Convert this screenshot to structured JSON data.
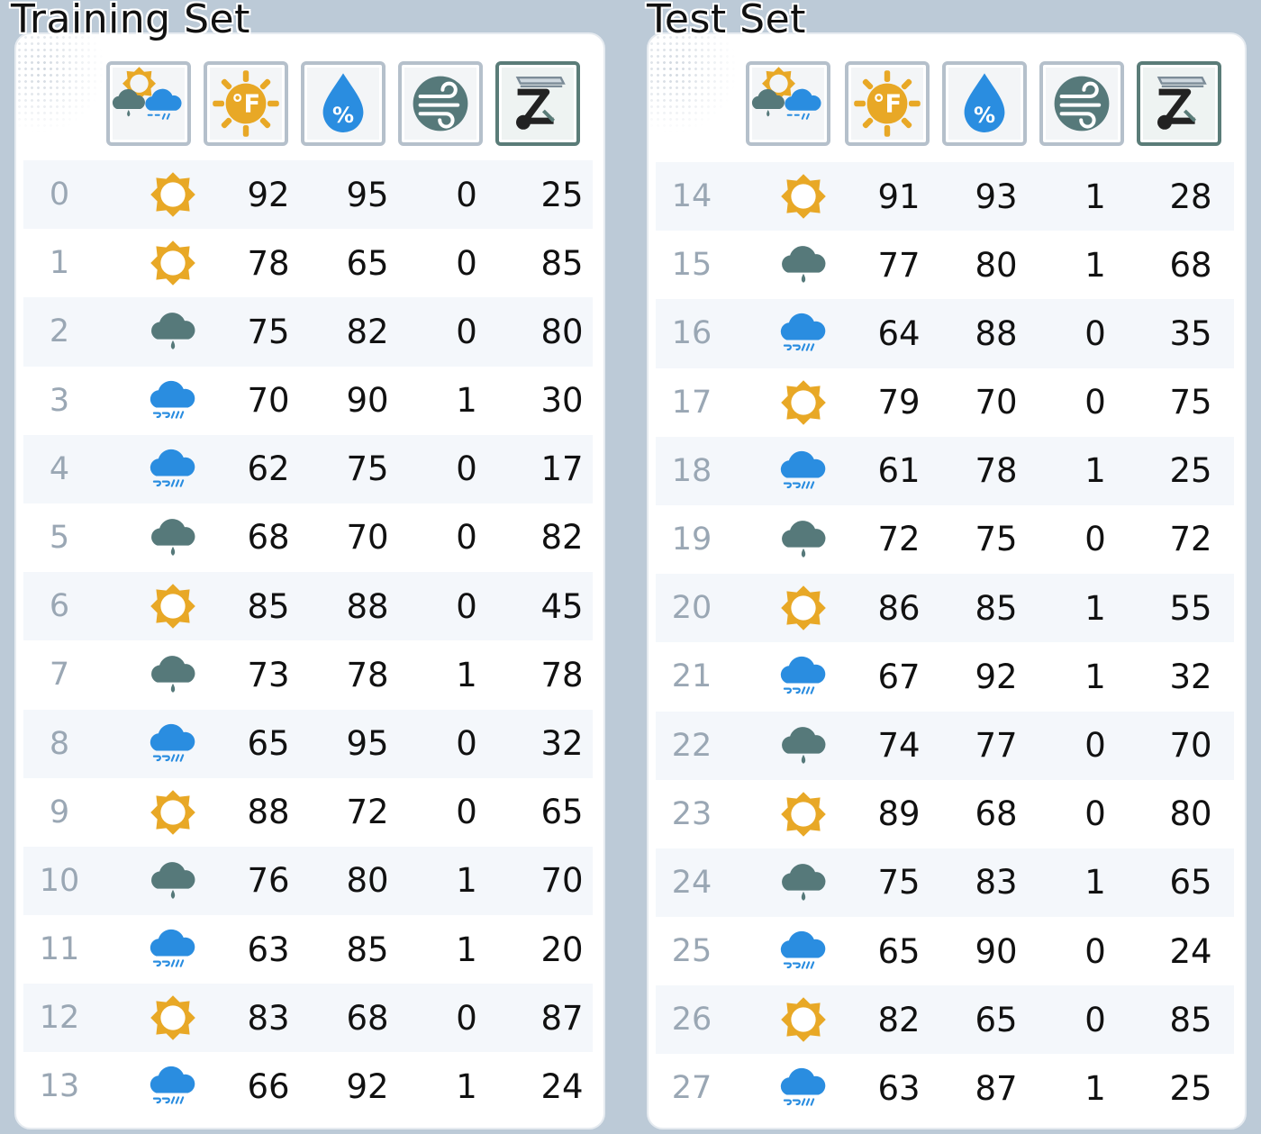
{
  "panels": [
    {
      "id": "train",
      "title": "Training Set",
      "rows": [
        {
          "idx": "0",
          "weather": "sunny",
          "temp": "92",
          "humidity": "95",
          "wind": "0",
          "target": "25"
        },
        {
          "idx": "1",
          "weather": "sunny",
          "temp": "78",
          "humidity": "65",
          "wind": "0",
          "target": "85"
        },
        {
          "idx": "2",
          "weather": "rainy-dark",
          "temp": "75",
          "humidity": "82",
          "wind": "0",
          "target": "80"
        },
        {
          "idx": "3",
          "weather": "rainy-blue",
          "temp": "70",
          "humidity": "90",
          "wind": "1",
          "target": "30"
        },
        {
          "idx": "4",
          "weather": "rainy-blue",
          "temp": "62",
          "humidity": "75",
          "wind": "0",
          "target": "17"
        },
        {
          "idx": "5",
          "weather": "rainy-dark",
          "temp": "68",
          "humidity": "70",
          "wind": "0",
          "target": "82"
        },
        {
          "idx": "6",
          "weather": "sunny",
          "temp": "85",
          "humidity": "88",
          "wind": "0",
          "target": "45"
        },
        {
          "idx": "7",
          "weather": "rainy-dark",
          "temp": "73",
          "humidity": "78",
          "wind": "1",
          "target": "78"
        },
        {
          "idx": "8",
          "weather": "rainy-blue",
          "temp": "65",
          "humidity": "95",
          "wind": "0",
          "target": "32"
        },
        {
          "idx": "9",
          "weather": "sunny",
          "temp": "88",
          "humidity": "72",
          "wind": "0",
          "target": "65"
        },
        {
          "idx": "10",
          "weather": "rainy-dark",
          "temp": "76",
          "humidity": "80",
          "wind": "1",
          "target": "70"
        },
        {
          "idx": "11",
          "weather": "rainy-blue",
          "temp": "63",
          "humidity": "85",
          "wind": "1",
          "target": "20"
        },
        {
          "idx": "12",
          "weather": "sunny",
          "temp": "83",
          "humidity": "68",
          "wind": "0",
          "target": "87"
        },
        {
          "idx": "13",
          "weather": "rainy-blue",
          "temp": "66",
          "humidity": "92",
          "wind": "1",
          "target": "24"
        }
      ]
    },
    {
      "id": "test",
      "title": "Test Set",
      "rows": [
        {
          "idx": "14",
          "weather": "sunny",
          "temp": "91",
          "humidity": "93",
          "wind": "1",
          "target": "28"
        },
        {
          "idx": "15",
          "weather": "rainy-dark",
          "temp": "77",
          "humidity": "80",
          "wind": "1",
          "target": "68"
        },
        {
          "idx": "16",
          "weather": "rainy-blue",
          "temp": "64",
          "humidity": "88",
          "wind": "0",
          "target": "35"
        },
        {
          "idx": "17",
          "weather": "sunny",
          "temp": "79",
          "humidity": "70",
          "wind": "0",
          "target": "75"
        },
        {
          "idx": "18",
          "weather": "rainy-blue",
          "temp": "61",
          "humidity": "78",
          "wind": "1",
          "target": "25"
        },
        {
          "idx": "19",
          "weather": "rainy-dark",
          "temp": "72",
          "humidity": "75",
          "wind": "0",
          "target": "72"
        },
        {
          "idx": "20",
          "weather": "sunny",
          "temp": "86",
          "humidity": "85",
          "wind": "1",
          "target": "55"
        },
        {
          "idx": "21",
          "weather": "rainy-blue",
          "temp": "67",
          "humidity": "92",
          "wind": "1",
          "target": "32"
        },
        {
          "idx": "22",
          "weather": "rainy-dark",
          "temp": "74",
          "humidity": "77",
          "wind": "0",
          "target": "70"
        },
        {
          "idx": "23",
          "weather": "sunny",
          "temp": "89",
          "humidity": "68",
          "wind": "0",
          "target": "80"
        },
        {
          "idx": "24",
          "weather": "rainy-dark",
          "temp": "75",
          "humidity": "83",
          "wind": "1",
          "target": "65"
        },
        {
          "idx": "25",
          "weather": "rainy-blue",
          "temp": "65",
          "humidity": "90",
          "wind": "0",
          "target": "24"
        },
        {
          "idx": "26",
          "weather": "sunny",
          "temp": "82",
          "humidity": "65",
          "wind": "0",
          "target": "85"
        },
        {
          "idx": "27",
          "weather": "rainy-blue",
          "temp": "63",
          "humidity": "87",
          "wind": "1",
          "target": "25"
        }
      ]
    }
  ],
  "header_icons": [
    "weather-outlook-icon",
    "temperature-icon",
    "humidity-icon",
    "wind-icon",
    "target-icon"
  ],
  "colors": {
    "sunny": "#e8a826",
    "rainy_dark": "#56797a",
    "rainy_blue": "#2a8de0",
    "index_text": "#9aa7b4",
    "row_alt": "#f4f7fb",
    "background": "#bccad7"
  }
}
